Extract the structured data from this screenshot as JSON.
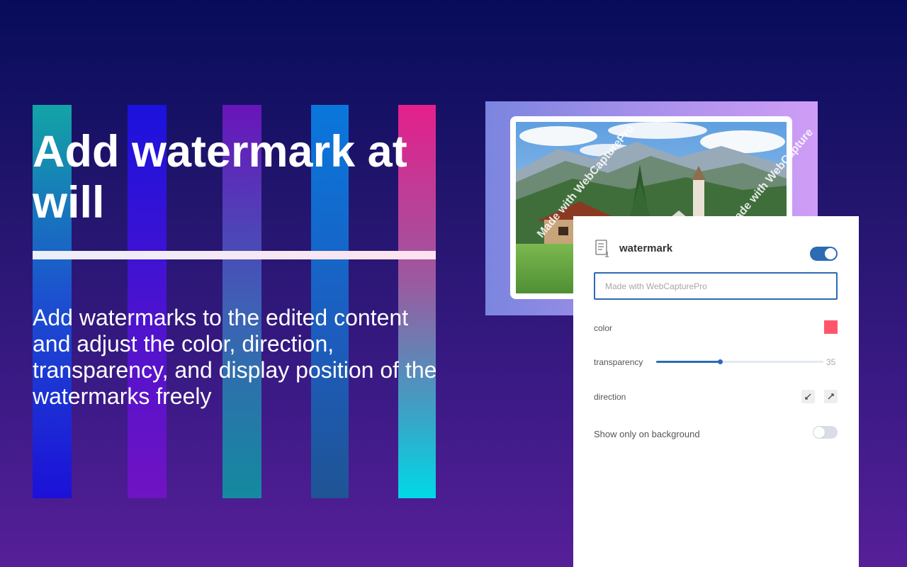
{
  "hero": {
    "title": "Add watermark at will",
    "description": "Add watermarks to the edited content and adjust the color, direction, transparency, and display position of the watermarks freely"
  },
  "preview": {
    "watermark_text_1": "Made with WebCapturePro",
    "watermark_text_2": "Made with WebCapturePro",
    "watermark_text_3": "Made with WebCapture"
  },
  "panel": {
    "title": "watermark",
    "enabled": true,
    "text_input": {
      "value": "",
      "placeholder": "Made with WebCapturePro"
    },
    "color_label": "color",
    "color_value": "#ff566b",
    "transparency_label": "transparency",
    "transparency_value": "35",
    "transparency_fraction": 0.38,
    "direction_label": "direction",
    "direction_options": [
      "diagonal-down-icon",
      "diagonal-up-icon"
    ],
    "background_only_label": "Show only on background",
    "background_only": false
  },
  "colors": {
    "accent": "#2d6bb3",
    "watermark": "#ff566b"
  }
}
